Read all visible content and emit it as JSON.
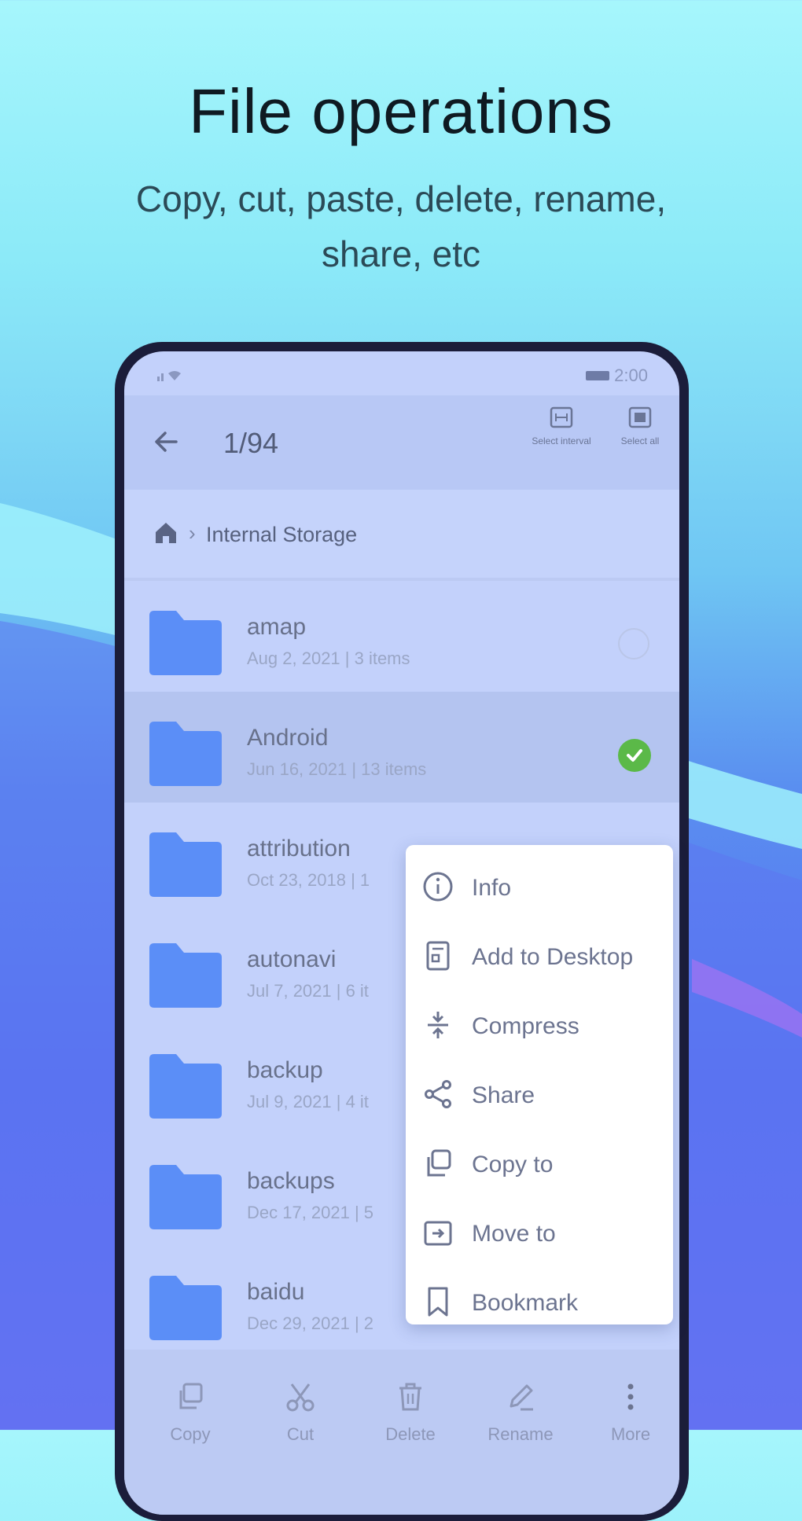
{
  "headline": "File operations",
  "subtitle": "Copy, cut, paste, delete, rename, share, etc",
  "status_bar": {
    "time": "2:00"
  },
  "app_bar": {
    "selection_count": "1/94",
    "actions": [
      {
        "label": "Select interval",
        "icon": "select-interval-icon"
      },
      {
        "label": "Select all",
        "icon": "select-all-icon"
      }
    ]
  },
  "breadcrumb": {
    "path": "Internal Storage",
    "home_icon": "home-icon"
  },
  "files": [
    {
      "name": "amap",
      "meta": "Aug 2, 2021  |  3 items",
      "selected": false
    },
    {
      "name": "Android",
      "meta": "Jun 16, 2021  |  13 items",
      "selected": true
    },
    {
      "name": "attribution",
      "meta": "Oct 23, 2018  |  1",
      "selected": false
    },
    {
      "name": "autonavi",
      "meta": "Jul 7, 2021  |  6 it",
      "selected": false
    },
    {
      "name": "backup",
      "meta": "Jul 9, 2021  |  4 it",
      "selected": false
    },
    {
      "name": "backups",
      "meta": "Dec 17, 2021  |  5",
      "selected": false
    },
    {
      "name": "baidu",
      "meta": "Dec 29, 2021  |  2",
      "selected": false
    }
  ],
  "context_menu": [
    {
      "label": "Info",
      "icon": "info-icon"
    },
    {
      "label": "Add to Desktop",
      "icon": "add-to-desktop-icon"
    },
    {
      "label": "Compress",
      "icon": "compress-icon"
    },
    {
      "label": "Share",
      "icon": "share-icon"
    },
    {
      "label": "Copy to",
      "icon": "copy-to-icon"
    },
    {
      "label": "Move to",
      "icon": "move-to-icon"
    },
    {
      "label": "Bookmark",
      "icon": "bookmark-icon"
    }
  ],
  "bottom_bar": [
    {
      "label": "Copy",
      "icon": "copy-icon"
    },
    {
      "label": "Cut",
      "icon": "cut-icon"
    },
    {
      "label": "Delete",
      "icon": "delete-icon"
    },
    {
      "label": "Rename",
      "icon": "rename-icon"
    },
    {
      "label": "More",
      "icon": "more-icon"
    }
  ],
  "colors": {
    "folder": "#5b8ef7",
    "selected_check": "#5bb948",
    "phone_frame": "#1b1d3a",
    "headline": "#0f1a22"
  }
}
